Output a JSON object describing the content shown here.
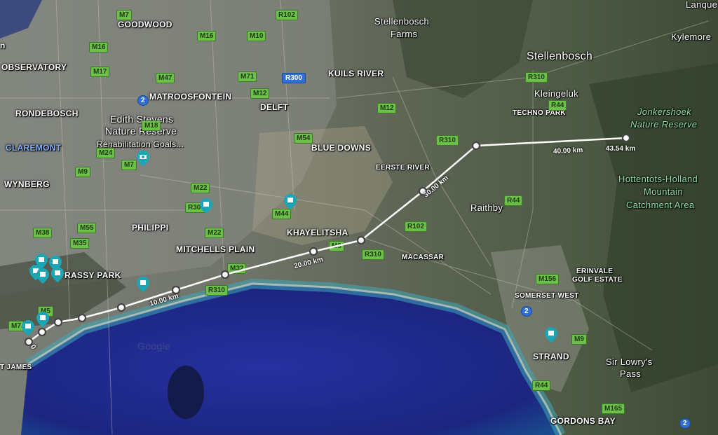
{
  "map": {
    "places": {
      "goodwood": "GOODWOOD",
      "observatory": "OBSERVATORY",
      "rondebosch": "RONDEBOSCH",
      "claremont": "CLAREMONT",
      "wynberg": "WYNBERG",
      "matroosfontein": "MATROOSFONTEIN",
      "delft": "DELFT",
      "kuils_river": "KUILS RIVER",
      "stellenbosch_farms_1": "Stellenbosch",
      "stellenbosch_farms_2": "Farms",
      "stellenbosch": "Stellenbosch",
      "kleingeluk": "Kleingeluk",
      "techno_park": "TECHNO PARK",
      "kylemore": "Kylemore",
      "lanquedoc": "Lanque",
      "blue_downs": "BLUE DOWNS",
      "eerste_river": "EERSTE RIVER",
      "khayelitsha": "KHAYELITSHA",
      "philippi": "PHILIPPI",
      "mitchells_plain": "MITCHELLS PLAIN",
      "grassy_park": "RASSY PARK",
      "macassar": "MACASSAR",
      "raithby": "Raithby",
      "erinvale_1": "ERINVALE",
      "erinvale_2": "GOLF ESTATE",
      "somerset_west": "SOMERSET WEST",
      "strand": "STRAND",
      "gordons_bay": "GORDONS BAY",
      "st_james": "T JAMES",
      "city_edge": "n",
      "sir_lowrys_1": "Sir Lowry's",
      "sir_lowrys_2": "Pass"
    },
    "parks": {
      "edith_1": "Edith Stevens",
      "edith_2": "Nature Reserve",
      "rehab": "Rehabilitation Goals...",
      "jonkershoek_1": "Jonkershoek",
      "jonkershoek_2": "Nature Reserve",
      "hottentots_1": "Hottentots-Holland",
      "hottentots_2": "Mountain",
      "hottentots_3": "Catchment Area"
    },
    "roads": [
      "M7",
      "M16",
      "M10",
      "R102",
      "M17",
      "M47",
      "M71",
      "R300",
      "R310",
      "M12",
      "M12",
      "M18",
      "M24",
      "M7",
      "M9",
      "M22",
      "R300",
      "M44",
      "M22",
      "M54",
      "R310",
      "R44",
      "M38",
      "M55",
      "M35",
      "M32",
      "R310",
      "M9",
      "R310",
      "R102",
      "M156",
      "M9",
      "R44",
      "M165",
      "R44",
      "M16",
      "M5",
      "M7"
    ],
    "route_shields": [
      "2",
      "2",
      "2"
    ],
    "measure": {
      "labels": [
        "0",
        "10.00 km",
        "20.00 km",
        "30.00 km",
        "40.00 km",
        "43.54 km"
      ],
      "total_km": 43.54
    },
    "watermark": "Google",
    "colors": {
      "ocean": "#1f2a8a",
      "ocean_shallow": "#2f8fa8",
      "land": "#5a6452",
      "urban": "#8a8c84",
      "pin": "#1aa6b7",
      "measure_line": "#ffffff"
    }
  }
}
